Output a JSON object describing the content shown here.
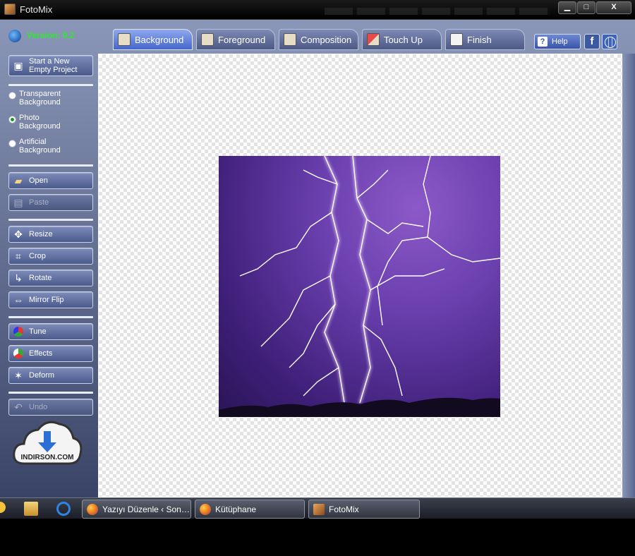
{
  "window": {
    "title": "FotoMix",
    "controls": {
      "minimize": "▁",
      "maximize": "□",
      "close": "X"
    }
  },
  "app": {
    "version": "Version: 9.2"
  },
  "tabs": [
    {
      "label": "Background",
      "active": true
    },
    {
      "label": "Foreground",
      "active": false
    },
    {
      "label": "Composition",
      "active": false
    },
    {
      "label": "Touch Up",
      "active": false
    },
    {
      "label": "Finish",
      "active": false
    }
  ],
  "header_buttons": {
    "help": "Help",
    "facebook": "f"
  },
  "sidebar": {
    "new_project": "Start a New Empty Project",
    "background_options": [
      {
        "label": "Transparent Background",
        "selected": false
      },
      {
        "label": "Photo Background",
        "selected": true
      },
      {
        "label": "Artificial Background",
        "selected": false
      }
    ],
    "file_buttons": {
      "open": "Open",
      "paste": "Paste"
    },
    "transform_buttons": {
      "resize": "Resize",
      "crop": "Crop",
      "rotate": "Rotate",
      "mirror": "Mirror Flip"
    },
    "adjust_buttons": {
      "tune": "Tune",
      "effects": "Effects",
      "deform": "Deform"
    },
    "undo": "Undo"
  },
  "watermark": {
    "brand": "INDIRSON.COM"
  },
  "taskbar": {
    "tasks": [
      {
        "label": "Yazıyı Düzenle ‹ Son ..."
      },
      {
        "label": "Kütüphane"
      },
      {
        "label": "FotoMix"
      }
    ]
  },
  "colors": {
    "version_text": "#2ee82e",
    "active_tab": "#4466cc",
    "sidebar_bg": "#5b6790",
    "photo_purple": "#6a3fae"
  }
}
